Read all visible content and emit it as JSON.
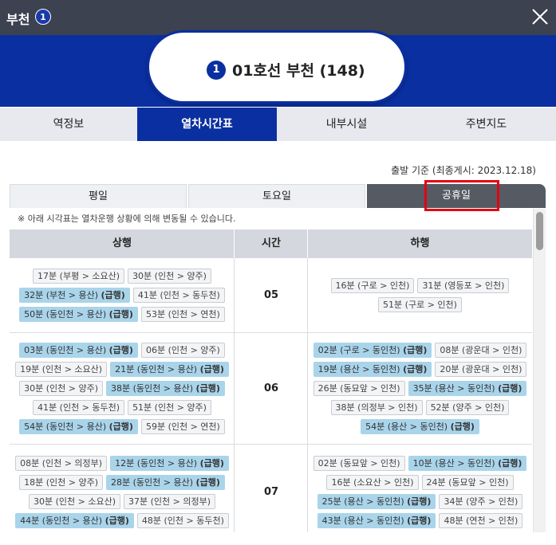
{
  "header": {
    "title": "부천",
    "badge": "1"
  },
  "station": {
    "line_num": "1",
    "name": "01호선 부천 (148)"
  },
  "tabs": [
    "역정보",
    "열차시간표",
    "내부시설",
    "주변지도"
  ],
  "active_tab": 1,
  "basis_text": "출발 기준 (최종게시: 2023.12.18)",
  "day_tabs": [
    "평일",
    "토요일",
    "공휴일"
  ],
  "notice": "※ 아래 시각표는 열차운행 상황에 의해 변동될 수 있습니다.",
  "table": {
    "headers": {
      "up": "상행",
      "hour": "시간",
      "down": "하행"
    },
    "rows": [
      {
        "hour": "05",
        "up": [
          {
            "text": "17분 (부평 > 소요산)",
            "express": false
          },
          {
            "text": "30분 (인천 > 양주)",
            "express": false
          },
          {
            "text": "32분 (부천 > 용산) ",
            "tag": "(급행)",
            "express": true
          },
          {
            "text": "41분 (인천 > 동두천)",
            "express": false
          },
          {
            "text": "50분 (동인천 > 용산) ",
            "tag": "(급행)",
            "express": true
          },
          {
            "text": "53분 (인천 > 연천)",
            "express": false
          }
        ],
        "down": [
          {
            "text": "16분 (구로 > 인천)",
            "express": false
          },
          {
            "text": "31분 (영등포 > 인천)",
            "express": false
          },
          {
            "text": "51분 (구로 > 인천)",
            "express": false
          }
        ]
      },
      {
        "hour": "06",
        "up": [
          {
            "text": "03분 (동인천 > 용산) ",
            "tag": "(급행)",
            "express": true
          },
          {
            "text": "06분 (인천 > 양주)",
            "express": false
          },
          {
            "text": "19분 (인천 > 소요산)",
            "express": false
          },
          {
            "text": "21분 (동인천 > 용산) ",
            "tag": "(급행)",
            "express": true
          },
          {
            "text": "30분 (인천 > 양주)",
            "express": false
          },
          {
            "text": "38분 (동인천 > 용산) ",
            "tag": "(급행)",
            "express": true
          },
          {
            "text": "41분 (인천 > 동두천)",
            "express": false
          },
          {
            "text": "51분 (인천 > 양주)",
            "express": false
          },
          {
            "text": "54분 (동인천 > 용산) ",
            "tag": "(급행)",
            "express": true
          },
          {
            "text": "59분 (인천 > 연천)",
            "express": false
          }
        ],
        "down": [
          {
            "text": "02분 (구로 > 동인천) ",
            "tag": "(급행)",
            "express": true
          },
          {
            "text": "08분 (광운대 > 인천)",
            "express": false
          },
          {
            "text": "19분 (용산 > 동인천) ",
            "tag": "(급행)",
            "express": true
          },
          {
            "text": "20분 (광운대 > 인천)",
            "express": false
          },
          {
            "text": "26분 (동묘앞 > 인천)",
            "express": false
          },
          {
            "text": "35분 (용산 > 동인천) ",
            "tag": "(급행)",
            "express": true
          },
          {
            "text": "38분 (의정부 > 인천)",
            "express": false
          },
          {
            "text": "52분 (양주 > 인천)",
            "express": false
          },
          {
            "text": "54분 (용산 > 동인천) ",
            "tag": "(급행)",
            "express": true
          }
        ]
      },
      {
        "hour": "07",
        "up": [
          {
            "text": "08분 (인천 > 의정부)",
            "express": false
          },
          {
            "text": "12분 (동인천 > 용산) ",
            "tag": "(급행)",
            "express": true
          },
          {
            "text": "18분 (인천 > 양주)",
            "express": false
          },
          {
            "text": "28분 (동인천 > 용산) ",
            "tag": "(급행)",
            "express": true
          },
          {
            "text": "30분 (인천 > 소요산)",
            "express": false
          },
          {
            "text": "37분 (인천 > 의정부)",
            "express": false
          },
          {
            "text": "44분 (동인천 > 용산) ",
            "tag": "(급행)",
            "express": true
          },
          {
            "text": "48분 (인천 > 동두천)",
            "express": false
          }
        ],
        "down": [
          {
            "text": "02분 (동묘앞 > 인천)",
            "express": false
          },
          {
            "text": "10분 (용산 > 동인천) ",
            "tag": "(급행)",
            "express": true
          },
          {
            "text": "16분 (소요산 > 인천)",
            "express": false
          },
          {
            "text": "24분 (동묘앞 > 인천)",
            "express": false
          },
          {
            "text": "25분 (용산 > 동인천) ",
            "tag": "(급행)",
            "express": true
          },
          {
            "text": "34분 (양주 > 인천)",
            "express": false
          },
          {
            "text": "43분 (용산 > 동인천) ",
            "tag": "(급행)",
            "express": true
          },
          {
            "text": "48분 (연천 > 인천)",
            "express": false
          }
        ]
      }
    ]
  },
  "colors": {
    "brand": "#0a2fa0",
    "topbar": "#3d4251",
    "express_chip": "#a9d4ea",
    "highlight": "#e50012"
  }
}
